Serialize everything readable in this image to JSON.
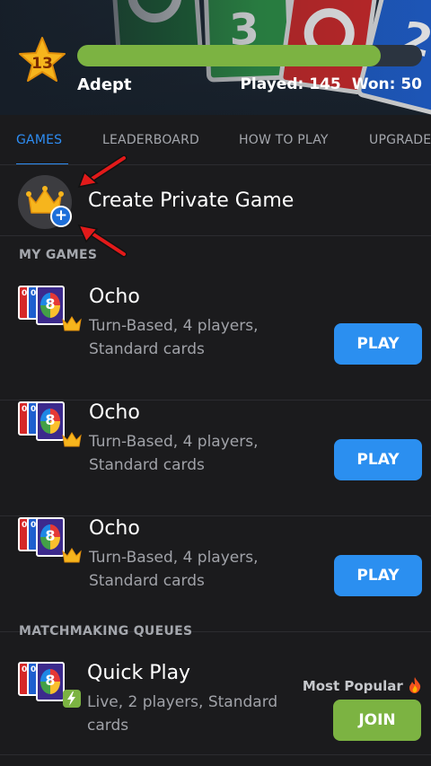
{
  "header": {
    "level": "13",
    "rank": "Adept",
    "xp_progress": 0.88,
    "played_label": "Played: 145",
    "won_label": "Won: 50"
  },
  "tabs": [
    {
      "label": "GAMES",
      "active": true
    },
    {
      "label": "LEADERBOARD",
      "active": false
    },
    {
      "label": "HOW TO PLAY",
      "active": false
    },
    {
      "label": "UPGRADE",
      "active": false
    }
  ],
  "create_private": {
    "label": "Create Private Game",
    "icon": "crown-plus-icon"
  },
  "my_games": {
    "title": "MY GAMES",
    "items": [
      {
        "name": "Ocho",
        "desc": "Turn-Based, 4 players, Standard cards",
        "button": "PLAY"
      },
      {
        "name": "Ocho",
        "desc": "Turn-Based, 4 players, Standard cards",
        "button": "PLAY"
      },
      {
        "name": "Ocho",
        "desc": "Turn-Based, 4 players, Standard cards",
        "button": "PLAY"
      }
    ]
  },
  "matchmaking": {
    "title": "MATCHMAKING QUEUES",
    "items": [
      {
        "name": "Quick Play",
        "desc": "Live, 2 players, Standard cards",
        "button": "JOIN",
        "badge": "Most Popular",
        "badge_icon": "fire-icon"
      }
    ]
  },
  "colors": {
    "accent": "#2e8df3",
    "play": "#2b8ff0",
    "join": "#7cb342",
    "xp": "#7cb342",
    "annotation_arrow": "#e21a1a"
  }
}
